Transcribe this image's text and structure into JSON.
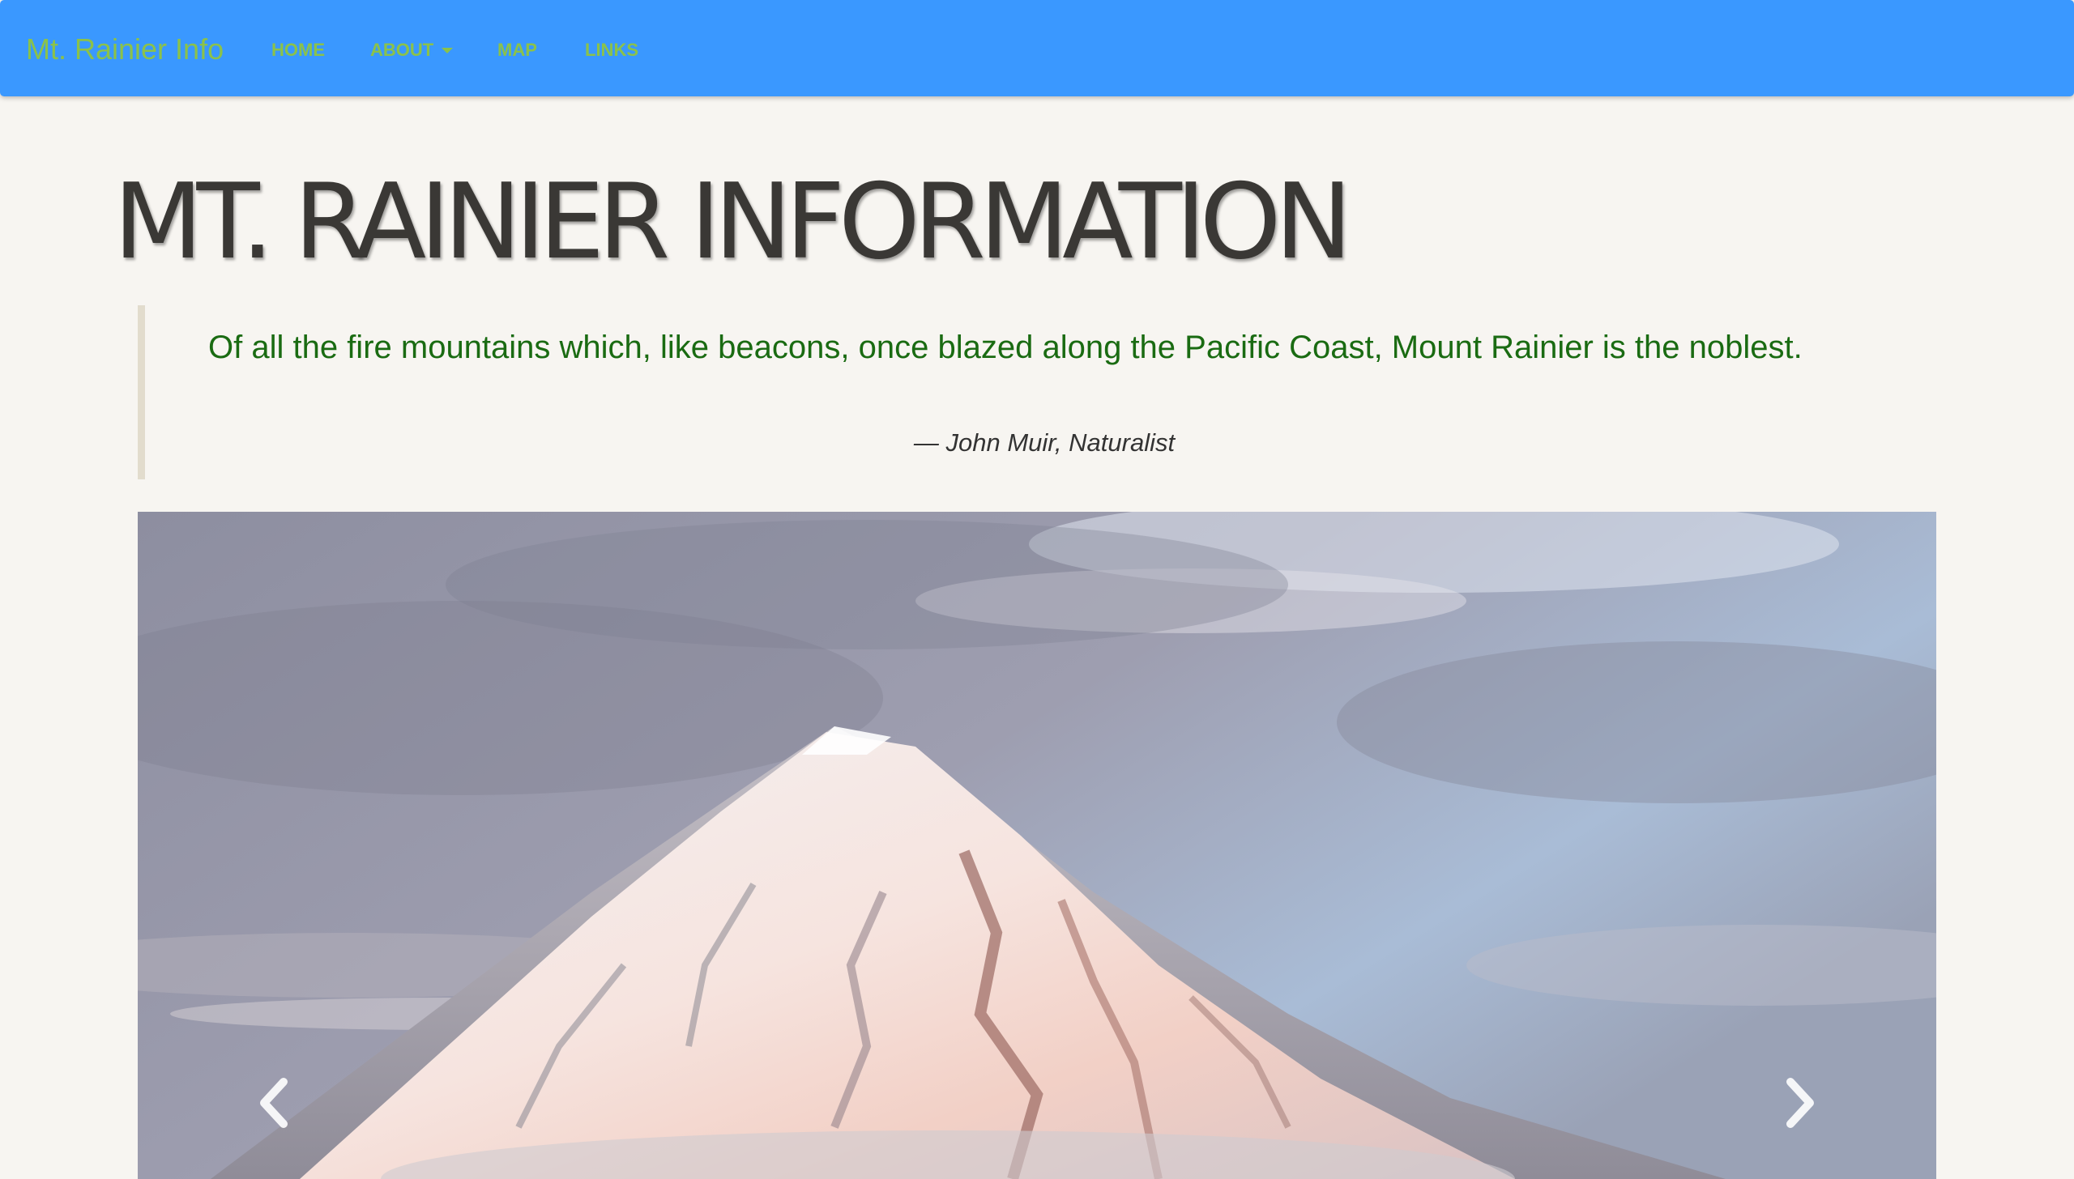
{
  "navbar": {
    "brand": "Mt. Rainier Info",
    "items": [
      {
        "label": "HOME"
      },
      {
        "label": "ABOUT"
      },
      {
        "label": "MAP"
      },
      {
        "label": "LINKS"
      }
    ],
    "colors": {
      "background": "#3a98ff",
      "text": "#8bc24a"
    }
  },
  "page": {
    "title": "MT. RAINIER INFORMATION"
  },
  "quote": {
    "text": "Of all the fire mountains which, like beacons, once blazed along the Pacific Coast, Mount Rainier is the noblest.",
    "source": "— John Muir, Naturalist"
  },
  "carousel": {
    "prev_icon": "chevron-left-icon",
    "next_icon": "chevron-right-icon"
  }
}
